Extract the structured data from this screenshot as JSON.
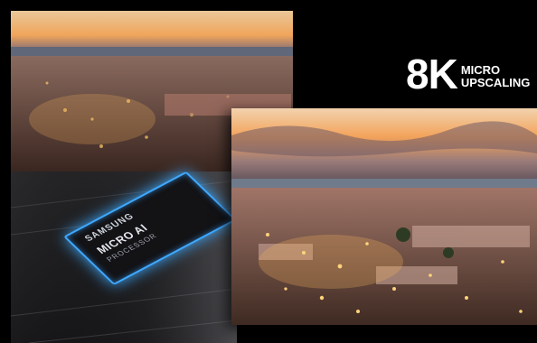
{
  "badge": {
    "resolution": "8K",
    "line1": "MICRO",
    "line2": "UPSCALING"
  },
  "chip": {
    "brand": "SAMSUNG",
    "label1": "MICRO AI",
    "label2": "PROCESSOR"
  },
  "colors": {
    "sunset": "#f3a35a",
    "city": "#5a3a30",
    "chip_glow": "#3fa9ff"
  }
}
